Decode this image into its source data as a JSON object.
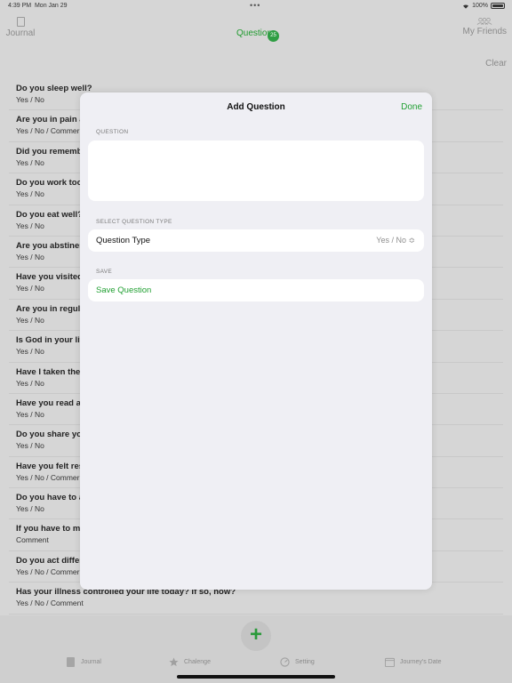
{
  "status": {
    "time": "4:39 PM",
    "date": "Mon Jan 29",
    "dots": "•••",
    "battery": "100%"
  },
  "nav": {
    "journal": "Journal",
    "questions": "Questions",
    "badge": "25",
    "friends": "My Friends",
    "clear": "Clear"
  },
  "questions": [
    {
      "q": "Do you sleep well?",
      "a": "Yes / No"
    },
    {
      "q": "Are you in pain a",
      "a": "Yes / No / Commer"
    },
    {
      "q": "Did you rememb",
      "a": "Yes / No"
    },
    {
      "q": "Do you work too",
      "a": "Yes / No"
    },
    {
      "q": "Do you eat well?",
      "a": "Yes / No"
    },
    {
      "q": "Are you abstiner",
      "a": "Yes / No"
    },
    {
      "q": "Have you visited",
      "a": "Yes / No"
    },
    {
      "q": "Are you in regula",
      "a": "Yes / No"
    },
    {
      "q": "Is God in your lif",
      "a": "Yes / No"
    },
    {
      "q": "Have I taken the",
      "a": "Yes / No"
    },
    {
      "q": "Have you read a",
      "a": "Yes / No"
    },
    {
      "q": "Do you share yo",
      "a": "Yes / No"
    },
    {
      "q": "Have you felt res",
      "a": "Yes / No / Commer"
    },
    {
      "q": "Do you have to a",
      "a": "Yes / No"
    },
    {
      "q": "If you have to ma",
      "a": "Comment"
    },
    {
      "q": "Do you act differ",
      "a": "Yes / No / Commer"
    },
    {
      "q": "Has your illness controlled your life today? If so, how?",
      "a": "Yes / No / Comment"
    }
  ],
  "modal": {
    "title": "Add Question",
    "done": "Done",
    "question_section": "QUESTION",
    "question_value": "",
    "type_section": "SELECT QUESTION TYPE",
    "type_label": "Question Type",
    "type_value": "Yes / No ≎",
    "save_section": "SAVE",
    "save_label": "Save Question"
  },
  "tabs": {
    "fab": "+",
    "journal": "Journal",
    "challenge": "Chalenge",
    "setting": "Setting",
    "journey": "Journey's Date"
  },
  "colors": {
    "accent": "#22a033",
    "badge": "#2f9e44"
  }
}
